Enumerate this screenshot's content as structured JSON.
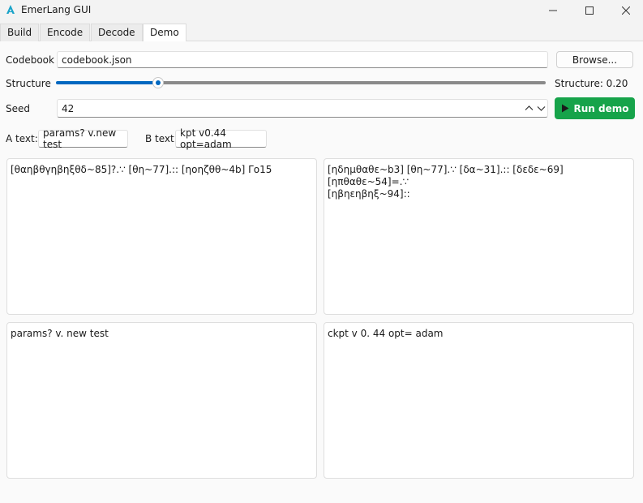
{
  "window": {
    "title": "EmerLang GUI"
  },
  "tabs": [
    {
      "label": "Build"
    },
    {
      "label": "Encode"
    },
    {
      "label": "Decode"
    },
    {
      "label": "Demo"
    }
  ],
  "active_tab": "Demo",
  "codebook": {
    "label": "Codebook",
    "value": "codebook.json",
    "browse_label": "Browse..."
  },
  "structure": {
    "label": "Structure",
    "value": 0.2,
    "readout": "Structure: 0.20"
  },
  "seed": {
    "label": "Seed",
    "value": "42"
  },
  "run_button": {
    "label": "Run demo"
  },
  "a_text": {
    "label": "A text:",
    "value": "params? v.new test"
  },
  "b_text": {
    "label": "B text:",
    "value": "kpt v0.44 opt=adam"
  },
  "panels": {
    "a_encoded": "[θαηβθγηβηξθδ~85]?.∵ [θη~77].:: [ηοηζθθ~4b] Γο15",
    "b_encoded": "[ηδημθαθε~b3] [θη~77].∵ [δα~31].:: [δεδε~69] [ηπθαθε~54]=.∵\n[ηβηεηβηξ~94]::",
    "a_decoded": "params? v. new test",
    "b_decoded": "ckpt v 0. 44 opt= adam"
  },
  "colors": {
    "accent": "#0067c0",
    "run_green": "#16a34a",
    "track_gray": "#8a8a8a"
  }
}
